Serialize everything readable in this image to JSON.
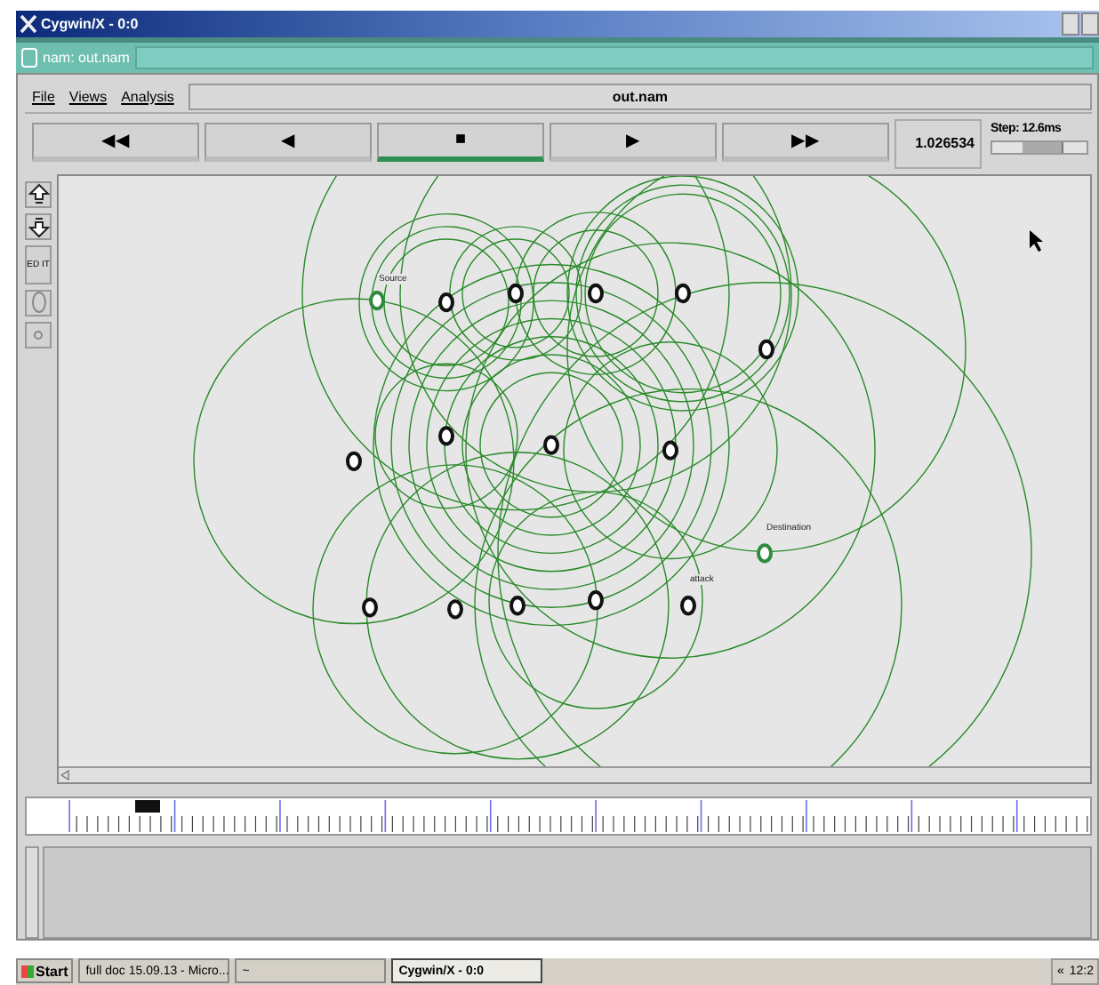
{
  "window": {
    "title": "Cygwin/X - 0:0"
  },
  "app_bar": {
    "title": "nam: out.nam"
  },
  "menu": [
    {
      "label": "File"
    },
    {
      "label": "Views"
    },
    {
      "label": "Analysis"
    }
  ],
  "file_field": {
    "value": "out.nam"
  },
  "playback": [
    {
      "glyph": "◀◀",
      "selected": false
    },
    {
      "glyph": "◀",
      "selected": false
    },
    {
      "glyph": "■",
      "selected": true
    },
    {
      "glyph": "▶",
      "selected": false
    },
    {
      "glyph": "▶▶",
      "selected": false
    }
  ],
  "time": "1.026534",
  "step": {
    "label": "Step: 12.6ms",
    "level": 0.75
  },
  "edit_button": "ED IT",
  "nodes": [
    {
      "label": "Source",
      "color": "#2e8b3e"
    },
    {
      "color": "#111111"
    },
    {
      "color": "#111111"
    },
    {
      "color": "#111111"
    },
    {
      "color": "#111111"
    },
    {
      "color": "#111111"
    },
    {
      "color": "#111111"
    },
    {
      "color": "#111111"
    },
    {
      "color": "#111111"
    },
    {
      "color": "#111111"
    },
    {
      "label": "Destination",
      "color": "#2e8b3e"
    },
    {
      "label": "attack",
      "color": "#111111"
    },
    {
      "color": "#111111"
    },
    {
      "color": "#111111"
    },
    {
      "color": "#111111"
    },
    {
      "color": "#111111"
    }
  ],
  "taskbar": {
    "start": "Start",
    "items": [
      {
        "label": "full doc 15.09.13 - Micro...",
        "selected": false
      },
      {
        "label": "~",
        "selected": false
      },
      {
        "label": "Cygwin/X - 0:0",
        "selected": true
      }
    ],
    "tray_arrow": "«",
    "clock": "12:2"
  }
}
